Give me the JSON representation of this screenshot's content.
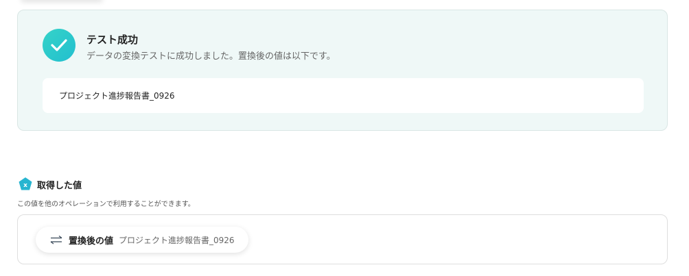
{
  "success": {
    "title": "テスト成功",
    "description": "データの変換テストに成功しました。置換後の値は以下です。",
    "result_value": "プロジェクト進捗報告書_0926"
  },
  "acquired": {
    "title": "取得した値",
    "description": "この値を他のオペレーションで利用することができます。",
    "items": [
      {
        "label": "置換後の値",
        "value": "プロジェクト進捗報告書_0926",
        "icon": "swap-arrows-icon"
      }
    ]
  },
  "colors": {
    "accent": "#22bfcf",
    "success_bg": "#eff8f7",
    "section_icon": "#27b5d0"
  }
}
